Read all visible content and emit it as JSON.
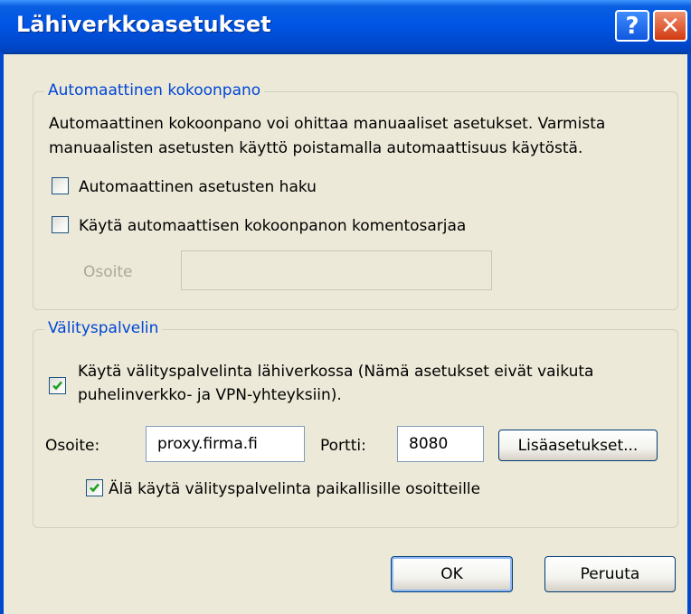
{
  "title": "Lähiverkkoasetukset",
  "title_buttons": {
    "help": "?",
    "close": "✕"
  },
  "auto_config": {
    "group_label": "Automaattinen kokoonpano",
    "description_line1": "Automaattinen kokoonpano voi ohittaa manuaaliset asetukset. Varmista",
    "description_line2": "manuaalisten asetusten käyttö poistamalla automaattisuus käytöstä.",
    "auto_detect": {
      "label": "Automaattinen asetusten haku",
      "checked": false
    },
    "use_script": {
      "label": "Käytä automaattisen kokoonpanon komentosarjaa",
      "checked": false
    },
    "address_label": "Osoite",
    "address_value": ""
  },
  "proxy": {
    "group_label": "Välityspalvelin",
    "use_proxy": {
      "label_line1": "Käytä välityspalvelinta lähiverkossa (Nämä asetukset eivät vaikuta",
      "label_line2": "puhelinverkko- ja VPN-yhteyksiin).",
      "checked": true
    },
    "address_label": "Osoite:",
    "address_value": "proxy.firma.fi",
    "port_label": "Portti:",
    "port_value": "8080",
    "advanced_button": "Lisäasetukset...",
    "bypass_local": {
      "label": "Älä käytä välityspalvelinta paikallisille osoitteille",
      "checked": true
    }
  },
  "buttons": {
    "ok": "OK",
    "cancel": "Peruuta"
  }
}
